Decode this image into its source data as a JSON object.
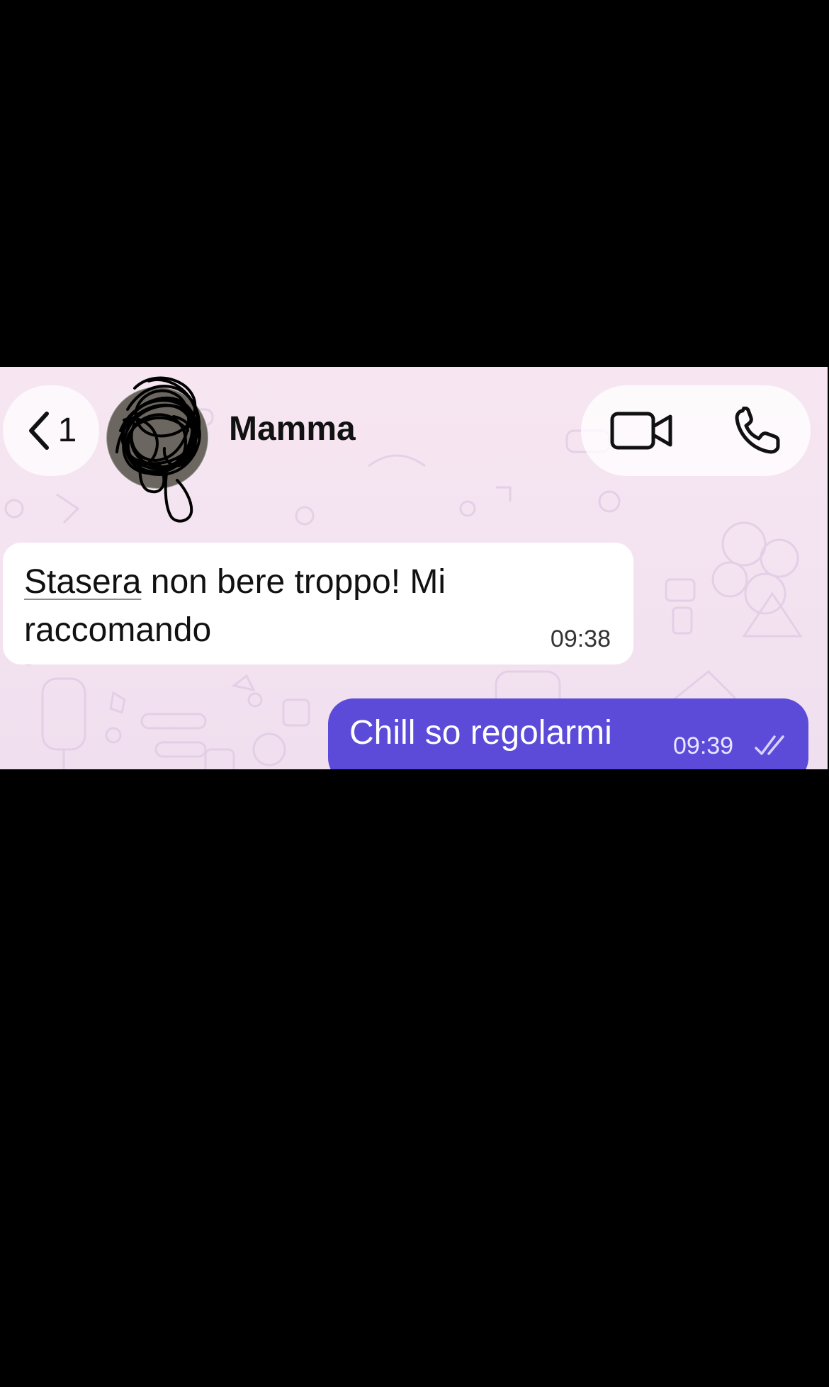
{
  "header": {
    "back_count": "1",
    "contact_name": "Mamma"
  },
  "messages": [
    {
      "direction": "incoming",
      "text_first": "Stasera",
      "text_rest": " non bere troppo! Mi raccomando",
      "time": "09:38"
    },
    {
      "direction": "outgoing",
      "text": "Chill so regolarmi",
      "time": "09:39",
      "status": "read"
    }
  ],
  "icons": {
    "back": "chevron-left-icon",
    "video": "video-camera-icon",
    "phone": "phone-icon",
    "ticks": "double-check-icon"
  },
  "colors": {
    "background": "#000000",
    "chat_background": "#f4e4f1",
    "incoming_bubble": "#ffffff",
    "outgoing_bubble": "#5b4bd8"
  }
}
